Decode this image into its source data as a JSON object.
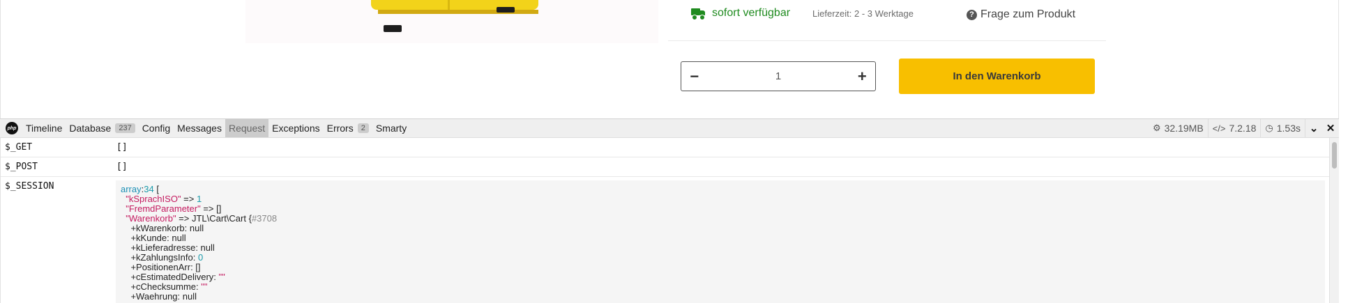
{
  "shop": {
    "availability": "sofort verfügbar",
    "delivery_time": "Lieferzeit: 2 - 3 Werktage",
    "question_link": "Frage zum Produkt",
    "quantity": "1",
    "minus": "−",
    "plus": "+",
    "add_to_cart": "In den Warenkorb",
    "accent_color": "#f8bf00",
    "availability_color": "#1f8b1f"
  },
  "debugbar": {
    "logo": "php",
    "tabs": [
      {
        "label": "Timeline"
      },
      {
        "label": "Database",
        "badge": "237"
      },
      {
        "label": "Config"
      },
      {
        "label": "Messages"
      },
      {
        "label": "Request"
      },
      {
        "label": "Exceptions"
      },
      {
        "label": "Errors",
        "badge": "2"
      },
      {
        "label": "Smarty"
      }
    ],
    "active_tab": "Request",
    "memory": "32.19MB",
    "php_version": "7.2.18",
    "duration": "1.53s"
  },
  "request": {
    "get_key": "$_GET",
    "get_val": "[]",
    "post_key": "$_POST",
    "post_val": "[]",
    "session_key": "$_SESSION",
    "dump": {
      "l1_type": "array",
      "l1_count": "34",
      "l1_open": " [",
      "l2_key": "\"kSprachISO\"",
      "l2_arrow": " => ",
      "l2_val": "1",
      "l3_key": "\"FremdParameter\"",
      "l3_rest": " => []",
      "l4_key": "\"Warenkorb\"",
      "l4_rest": " => JTL\\Cart\\Cart {",
      "l4_ref": "#3708",
      "l5": "+kWarenkorb: null",
      "l6": "+kKunde: null",
      "l7": "+kLieferadresse: null",
      "l8_prop": "+kZahlungsInfo: ",
      "l8_val": "0",
      "l9": "+PositionenArr: []",
      "l10_prop": "+cEstimatedDelivery: ",
      "l10_val": "\"\"",
      "l11_prop": "+cChecksumme: ",
      "l11_val": "\"\"",
      "l12": "+Waehrung: null"
    }
  }
}
